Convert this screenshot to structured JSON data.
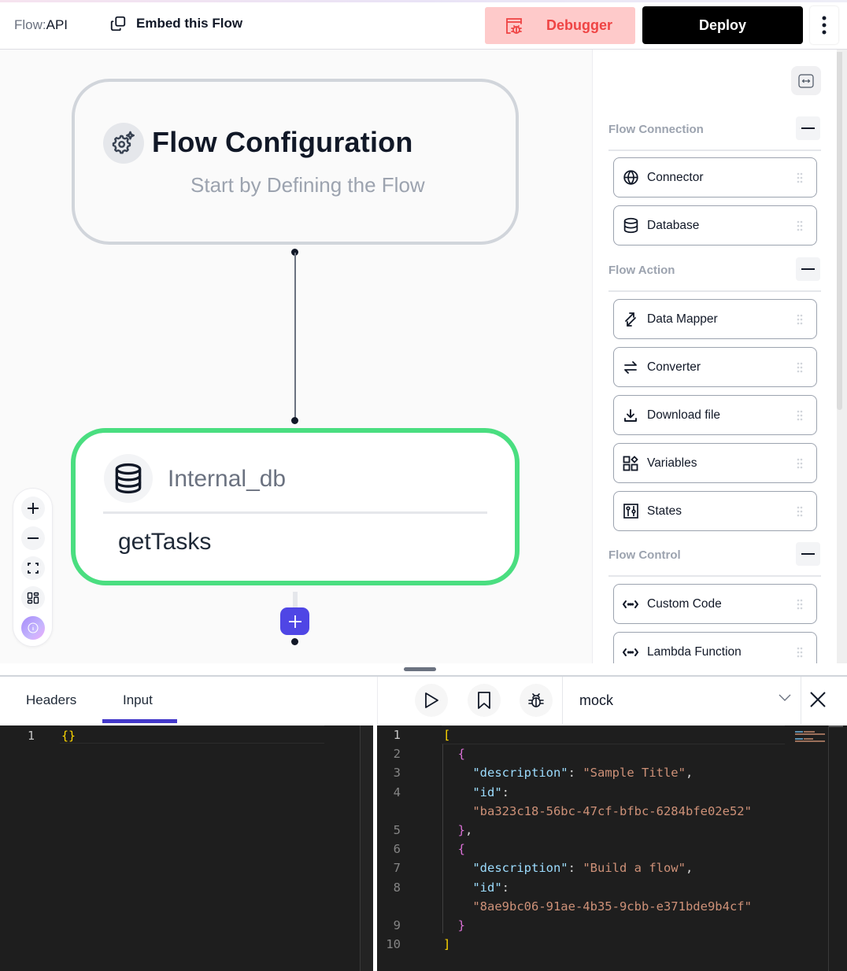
{
  "header": {
    "brand_prefix": "Flow:",
    "brand_name": "API",
    "embed_label": "Embed this Flow",
    "debugger_label": "Debugger",
    "deploy_label": "Deploy"
  },
  "colors": {
    "accent": "#4f46e5",
    "node_active_border": "#4ade80",
    "debugger_bg": "#fecaca",
    "debugger_text": "#ef4444",
    "tab_underline": "#4338ca"
  },
  "canvas": {
    "config_node": {
      "title": "Flow Configuration",
      "subtitle": "Start by Defining the Flow",
      "icon": "gear-sparkle-icon"
    },
    "db_node": {
      "title": "Internal_db",
      "operation": "getTasks",
      "icon": "database-icon"
    },
    "zoom_controls": [
      {
        "name": "zoom-in",
        "icon": "plus-icon"
      },
      {
        "name": "zoom-out",
        "icon": "minus-icon"
      },
      {
        "name": "fit-view",
        "icon": "fullscreen-icon"
      },
      {
        "name": "layout",
        "icon": "layout-icon"
      },
      {
        "name": "info",
        "icon": "info-icon"
      }
    ]
  },
  "sidebar": {
    "sections": [
      {
        "title": "Flow Connection",
        "items": [
          {
            "label": "Connector",
            "icon": "globe-icon"
          },
          {
            "label": "Database",
            "icon": "database-icon"
          }
        ]
      },
      {
        "title": "Flow Action",
        "items": [
          {
            "label": "Data Mapper",
            "icon": "arrows-diagonal-icon"
          },
          {
            "label": "Converter",
            "icon": "arrows-exchange-icon"
          },
          {
            "label": "Download file",
            "icon": "download-icon"
          },
          {
            "label": "Variables",
            "icon": "variables-icon"
          },
          {
            "label": "States",
            "icon": "sliders-icon"
          }
        ]
      },
      {
        "title": "Flow Control",
        "items": [
          {
            "label": "Custom Code",
            "icon": "code-dots-icon"
          },
          {
            "label": "Lambda Function",
            "icon": "code-dots-icon"
          }
        ]
      }
    ]
  },
  "bottom": {
    "tabs": [
      {
        "label": "Headers",
        "active": false
      },
      {
        "label": "Input",
        "active": true
      }
    ],
    "input_editor": {
      "lines": [
        "{}"
      ]
    },
    "toolbar": {
      "run": "play-icon",
      "save": "bookmark-icon",
      "debug": "bug-icon",
      "select_value": "mock"
    },
    "output_editor": {
      "rows": [
        {
          "ln": "1",
          "text": "["
        },
        {
          "ln": "2",
          "text": "  {"
        },
        {
          "ln": "3",
          "key": "\"description\"",
          "sep": ": ",
          "value": "\"Sample Title\"",
          "tail": ","
        },
        {
          "ln": "4",
          "key": "\"id\"",
          "sep": ":",
          "value": "",
          "tail": ""
        },
        {
          "ln": "",
          "key": "",
          "sep": "",
          "value": "\"ba323c18-56bc-47cf-bfbc-6284bfe02e52\"",
          "tail": ""
        },
        {
          "ln": "5",
          "text": "  },"
        },
        {
          "ln": "6",
          "text": "  {"
        },
        {
          "ln": "7",
          "key": "\"description\"",
          "sep": ": ",
          "value": "\"Build a flow\"",
          "tail": ","
        },
        {
          "ln": "8",
          "key": "\"id\"",
          "sep": ":",
          "value": "",
          "tail": ""
        },
        {
          "ln": "",
          "key": "",
          "sep": "",
          "value": "\"8ae9bc06-91ae-4b35-9cbb-e371bde9b4cf\"",
          "tail": ""
        },
        {
          "ln": "9",
          "text": "  }"
        },
        {
          "ln": "10",
          "text": "]"
        }
      ]
    }
  }
}
